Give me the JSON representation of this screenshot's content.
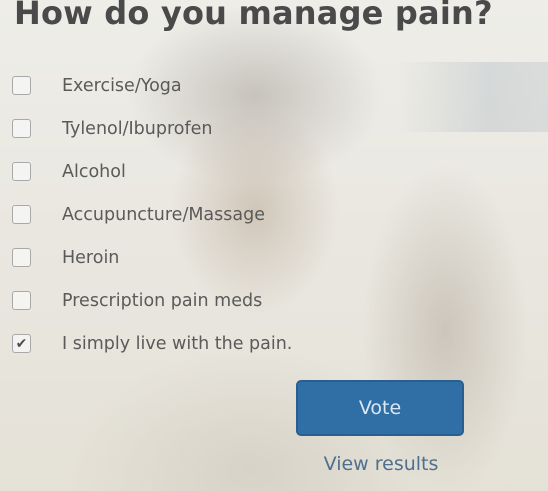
{
  "poll": {
    "question": "How do you manage pain?",
    "options": [
      {
        "label": "Exercise/Yoga",
        "checked": false,
        "mark": ""
      },
      {
        "label": "Tylenol/Ibuprofen",
        "checked": false,
        "mark": ""
      },
      {
        "label": "Alcohol",
        "checked": false,
        "mark": ""
      },
      {
        "label": "Accupuncture/Massage",
        "checked": false,
        "mark": ""
      },
      {
        "label": "Heroin",
        "checked": false,
        "mark": ""
      },
      {
        "label": "Prescription pain meds",
        "checked": false,
        "mark": ""
      },
      {
        "label": "I simply live with the pain.",
        "checked": true,
        "mark": "✔"
      }
    ],
    "vote_label": "Vote",
    "view_results_label": "View results"
  },
  "colors": {
    "title_text": "#4a4a4a",
    "option_text": "#5a5a5a",
    "vote_button_bg": "#2f6fa6",
    "vote_button_text": "#dce7f2",
    "link_text": "#4f6f8f"
  },
  "icons": {
    "checkbox": "checkbox-icon",
    "checkmark": "checkmark-icon"
  }
}
